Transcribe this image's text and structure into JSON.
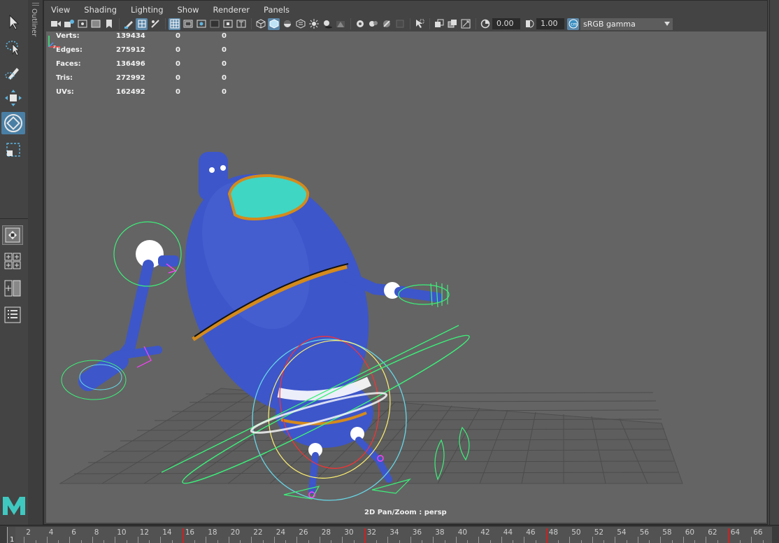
{
  "toolbox": {
    "tools": [
      {
        "name": "select-tool-icon"
      },
      {
        "name": "lasso-tool-icon"
      },
      {
        "name": "paint-select-tool-icon"
      },
      {
        "name": "move-tool-icon"
      },
      {
        "name": "rotate-tool-icon"
      },
      {
        "name": "scale-tool-icon"
      }
    ],
    "active_tool": "rotate-tool-icon"
  },
  "outliner": {
    "label": "Outliner"
  },
  "menubar": {
    "items": [
      "View",
      "Shading",
      "Lighting",
      "Show",
      "Renderer",
      "Panels"
    ]
  },
  "panel_toolbar": {
    "exposure": "0.00",
    "gamma": "1.00",
    "color_space": "sRGB gamma"
  },
  "hud": {
    "rows": [
      {
        "label": "Verts:",
        "v1": "139434",
        "v2": "0",
        "v3": "0"
      },
      {
        "label": "Edges:",
        "v1": "275912",
        "v2": "0",
        "v3": "0"
      },
      {
        "label": "Faces:",
        "v1": "136496",
        "v2": "0",
        "v3": "0"
      },
      {
        "label": "Tris:",
        "v1": "272992",
        "v2": "0",
        "v3": "0"
      },
      {
        "label": "UVs:",
        "v1": "162492",
        "v2": "0",
        "v3": "0"
      }
    ]
  },
  "viewport": {
    "camera_label": "2D Pan/Zoom : persp"
  },
  "colors": {
    "viewport_bg": "#646464",
    "robot_blue": "#3d56c9",
    "visor": "#3fd6c4",
    "trim": "#d48a1c",
    "control_green": "#3cf07a",
    "accent": "#4a7fa5"
  },
  "timeline": {
    "current_frame": "1",
    "tick_labels": [
      "2",
      "4",
      "6",
      "8",
      "10",
      "12",
      "14",
      "16",
      "18",
      "20",
      "22",
      "24",
      "26",
      "28",
      "30",
      "32",
      "34",
      "36",
      "38",
      "40",
      "42",
      "44",
      "46",
      "48",
      "50",
      "52",
      "54",
      "56",
      "58",
      "60",
      "62",
      "64",
      "66"
    ],
    "key_frames": [
      16,
      32,
      48,
      64
    ]
  }
}
